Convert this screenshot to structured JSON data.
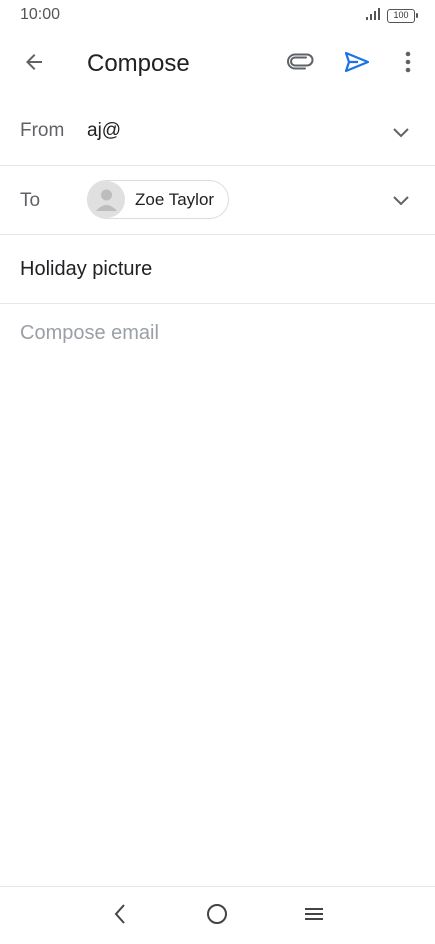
{
  "status_bar": {
    "time": "10:00",
    "battery": "100"
  },
  "app_bar": {
    "title": "Compose",
    "icons": {
      "back": "arrow-back-icon",
      "attach": "paperclip-icon",
      "send": "send-icon",
      "more": "more-vert-icon"
    },
    "accent_color": "#1a73e8"
  },
  "from": {
    "label": "From",
    "value": "aj@"
  },
  "to": {
    "label": "To",
    "recipients": [
      {
        "name": "Zoe Taylor"
      }
    ]
  },
  "subject": {
    "value": "Holiday picture"
  },
  "body": {
    "placeholder": "Compose email"
  }
}
